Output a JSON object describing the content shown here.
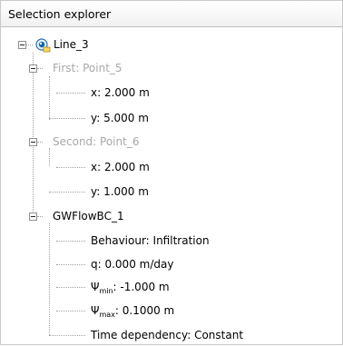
{
  "header": {
    "title": "Selection explorer"
  },
  "tree": {
    "root": {
      "label": "Line_3",
      "icon": "line-object-icon"
    },
    "first": {
      "label": "First: Point_5",
      "x": "x: 2.000 m",
      "y": "y: 5.000 m"
    },
    "second": {
      "label": "Second: Point_6",
      "x": "x: 2.000 m",
      "y": "y: 1.000 m"
    },
    "bc": {
      "label": "GWFlowBC_1",
      "behaviour": "Behaviour: Infiltration",
      "q": "q: 0.000 m/day",
      "psi_min_sym": "Ψ",
      "psi_min_sub": "min",
      "psi_min_val": ": -1.000 m",
      "psi_max_sym": "Ψ",
      "psi_max_sub": "max",
      "psi_max_val": ": 0.1000 m",
      "time": "Time dependency: Constant"
    }
  }
}
